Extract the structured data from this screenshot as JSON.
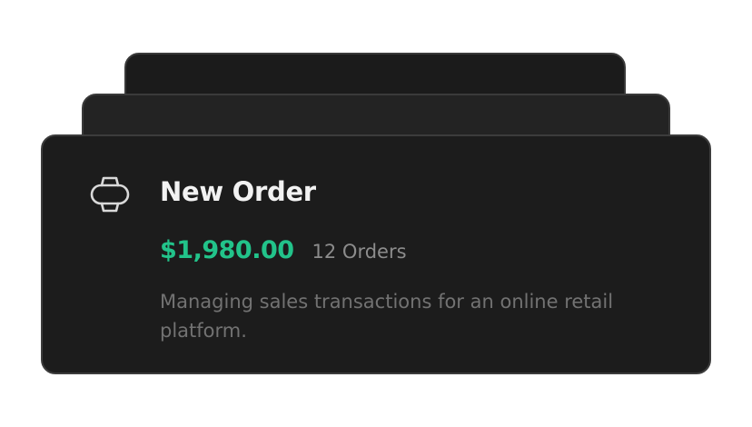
{
  "card": {
    "icon": "watch-icon",
    "title": "New Order",
    "price": "$1,980.00",
    "orders": "12 Orders",
    "description": "Managing sales transactions for an online retail platform."
  },
  "colors": {
    "card_background": "#1c1c1c",
    "card_border": "#3c3c3c",
    "title": "#f2f2f2",
    "price_accent": "#22c38a",
    "muted_text": "#8c8c8c"
  }
}
